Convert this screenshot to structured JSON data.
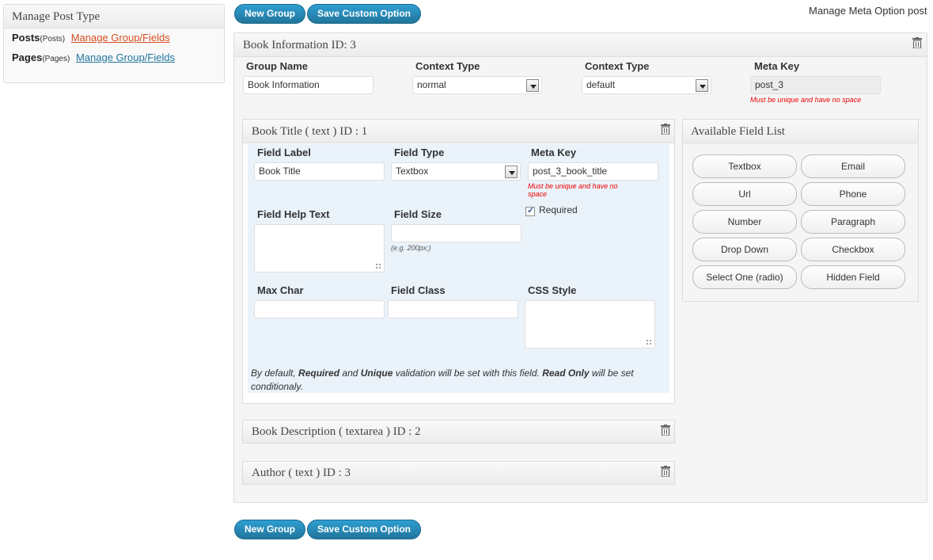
{
  "sidebar": {
    "title": "Manage Post Type",
    "items": [
      {
        "name": "Posts",
        "sub": "(Posts)",
        "link": "Manage Group/Fields"
      },
      {
        "name": "Pages",
        "sub": "(Pages)",
        "link": "Manage Group/Fields"
      }
    ]
  },
  "toolbar": {
    "new_group": "New Group",
    "save_option": "Save Custom Option"
  },
  "page_title": "Manage Meta Option post",
  "group": {
    "header": "Book Information ID: 3",
    "labels": {
      "name": "Group Name",
      "context1": "Context Type",
      "context2": "Context Type",
      "meta_key": "Meta Key"
    },
    "values": {
      "name": "Book Information",
      "context1": "normal",
      "context2": "default",
      "meta_key": "post_3"
    },
    "meta_hint": "Must be unique and have no space"
  },
  "field": {
    "header": "Book Title ( text ) ID : 1",
    "labels": {
      "label": "Field Label",
      "type": "Field Type",
      "meta_key": "Meta Key",
      "help": "Field Help Text",
      "size": "Field Size",
      "required": "Required",
      "max_char": "Max Char",
      "class": "Field Class",
      "css": "CSS Style"
    },
    "values": {
      "label": "Book Title",
      "type": "Textbox",
      "meta_key": "post_3_book_title"
    },
    "meta_hint_1": "Must be unique and have no",
    "meta_hint_2": "space",
    "size_hint": "(e.g. 200px;)",
    "note_1": "By default, ",
    "note_required": "Required",
    "note_2": " and ",
    "note_unique": "Unique",
    "note_3": " validation will be set with this field. ",
    "note_readonly": "Read Only",
    "note_4": " will be set conditionaly."
  },
  "collapsed": [
    {
      "header": "Book Description ( textarea ) ID : 2"
    },
    {
      "header": "Author ( text ) ID : 3"
    }
  ],
  "available": {
    "title": "Available Field List",
    "buttons": [
      "Textbox",
      "Email",
      "Url",
      "Phone",
      "Number",
      "Paragraph",
      "Drop Down",
      "Checkbox",
      "Select One (radio)",
      "Hidden Field"
    ]
  }
}
